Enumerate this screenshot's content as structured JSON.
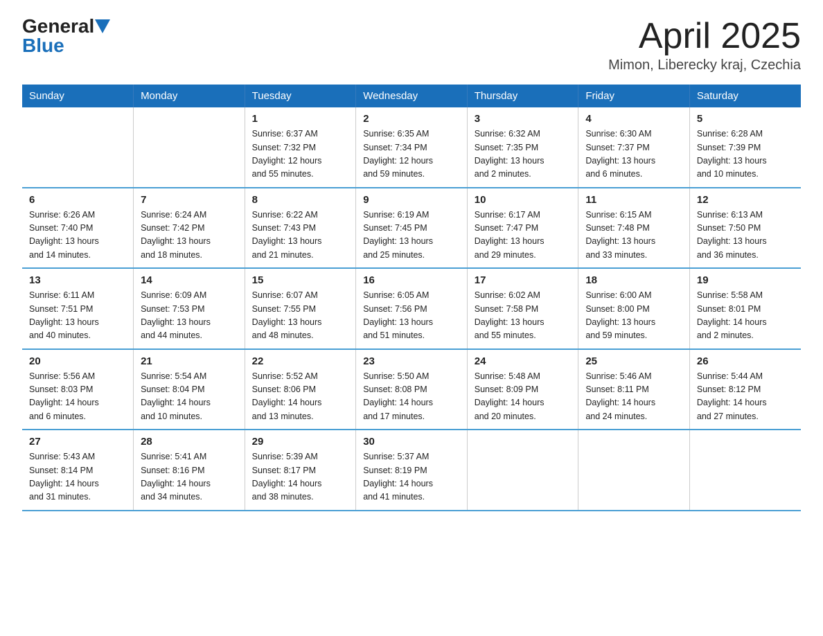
{
  "header": {
    "logo_general": "General",
    "logo_blue": "Blue",
    "title": "April 2025",
    "subtitle": "Mimon, Liberecky kraj, Czechia"
  },
  "weekdays": [
    "Sunday",
    "Monday",
    "Tuesday",
    "Wednesday",
    "Thursday",
    "Friday",
    "Saturday"
  ],
  "weeks": [
    [
      {
        "day": "",
        "info": ""
      },
      {
        "day": "",
        "info": ""
      },
      {
        "day": "1",
        "info": "Sunrise: 6:37 AM\nSunset: 7:32 PM\nDaylight: 12 hours\nand 55 minutes."
      },
      {
        "day": "2",
        "info": "Sunrise: 6:35 AM\nSunset: 7:34 PM\nDaylight: 12 hours\nand 59 minutes."
      },
      {
        "day": "3",
        "info": "Sunrise: 6:32 AM\nSunset: 7:35 PM\nDaylight: 13 hours\nand 2 minutes."
      },
      {
        "day": "4",
        "info": "Sunrise: 6:30 AM\nSunset: 7:37 PM\nDaylight: 13 hours\nand 6 minutes."
      },
      {
        "day": "5",
        "info": "Sunrise: 6:28 AM\nSunset: 7:39 PM\nDaylight: 13 hours\nand 10 minutes."
      }
    ],
    [
      {
        "day": "6",
        "info": "Sunrise: 6:26 AM\nSunset: 7:40 PM\nDaylight: 13 hours\nand 14 minutes."
      },
      {
        "day": "7",
        "info": "Sunrise: 6:24 AM\nSunset: 7:42 PM\nDaylight: 13 hours\nand 18 minutes."
      },
      {
        "day": "8",
        "info": "Sunrise: 6:22 AM\nSunset: 7:43 PM\nDaylight: 13 hours\nand 21 minutes."
      },
      {
        "day": "9",
        "info": "Sunrise: 6:19 AM\nSunset: 7:45 PM\nDaylight: 13 hours\nand 25 minutes."
      },
      {
        "day": "10",
        "info": "Sunrise: 6:17 AM\nSunset: 7:47 PM\nDaylight: 13 hours\nand 29 minutes."
      },
      {
        "day": "11",
        "info": "Sunrise: 6:15 AM\nSunset: 7:48 PM\nDaylight: 13 hours\nand 33 minutes."
      },
      {
        "day": "12",
        "info": "Sunrise: 6:13 AM\nSunset: 7:50 PM\nDaylight: 13 hours\nand 36 minutes."
      }
    ],
    [
      {
        "day": "13",
        "info": "Sunrise: 6:11 AM\nSunset: 7:51 PM\nDaylight: 13 hours\nand 40 minutes."
      },
      {
        "day": "14",
        "info": "Sunrise: 6:09 AM\nSunset: 7:53 PM\nDaylight: 13 hours\nand 44 minutes."
      },
      {
        "day": "15",
        "info": "Sunrise: 6:07 AM\nSunset: 7:55 PM\nDaylight: 13 hours\nand 48 minutes."
      },
      {
        "day": "16",
        "info": "Sunrise: 6:05 AM\nSunset: 7:56 PM\nDaylight: 13 hours\nand 51 minutes."
      },
      {
        "day": "17",
        "info": "Sunrise: 6:02 AM\nSunset: 7:58 PM\nDaylight: 13 hours\nand 55 minutes."
      },
      {
        "day": "18",
        "info": "Sunrise: 6:00 AM\nSunset: 8:00 PM\nDaylight: 13 hours\nand 59 minutes."
      },
      {
        "day": "19",
        "info": "Sunrise: 5:58 AM\nSunset: 8:01 PM\nDaylight: 14 hours\nand 2 minutes."
      }
    ],
    [
      {
        "day": "20",
        "info": "Sunrise: 5:56 AM\nSunset: 8:03 PM\nDaylight: 14 hours\nand 6 minutes."
      },
      {
        "day": "21",
        "info": "Sunrise: 5:54 AM\nSunset: 8:04 PM\nDaylight: 14 hours\nand 10 minutes."
      },
      {
        "day": "22",
        "info": "Sunrise: 5:52 AM\nSunset: 8:06 PM\nDaylight: 14 hours\nand 13 minutes."
      },
      {
        "day": "23",
        "info": "Sunrise: 5:50 AM\nSunset: 8:08 PM\nDaylight: 14 hours\nand 17 minutes."
      },
      {
        "day": "24",
        "info": "Sunrise: 5:48 AM\nSunset: 8:09 PM\nDaylight: 14 hours\nand 20 minutes."
      },
      {
        "day": "25",
        "info": "Sunrise: 5:46 AM\nSunset: 8:11 PM\nDaylight: 14 hours\nand 24 minutes."
      },
      {
        "day": "26",
        "info": "Sunrise: 5:44 AM\nSunset: 8:12 PM\nDaylight: 14 hours\nand 27 minutes."
      }
    ],
    [
      {
        "day": "27",
        "info": "Sunrise: 5:43 AM\nSunset: 8:14 PM\nDaylight: 14 hours\nand 31 minutes."
      },
      {
        "day": "28",
        "info": "Sunrise: 5:41 AM\nSunset: 8:16 PM\nDaylight: 14 hours\nand 34 minutes."
      },
      {
        "day": "29",
        "info": "Sunrise: 5:39 AM\nSunset: 8:17 PM\nDaylight: 14 hours\nand 38 minutes."
      },
      {
        "day": "30",
        "info": "Sunrise: 5:37 AM\nSunset: 8:19 PM\nDaylight: 14 hours\nand 41 minutes."
      },
      {
        "day": "",
        "info": ""
      },
      {
        "day": "",
        "info": ""
      },
      {
        "day": "",
        "info": ""
      }
    ]
  ],
  "colors": {
    "header_bg": "#1a6fba",
    "header_text": "#ffffff",
    "border": "#4a9fd4"
  }
}
